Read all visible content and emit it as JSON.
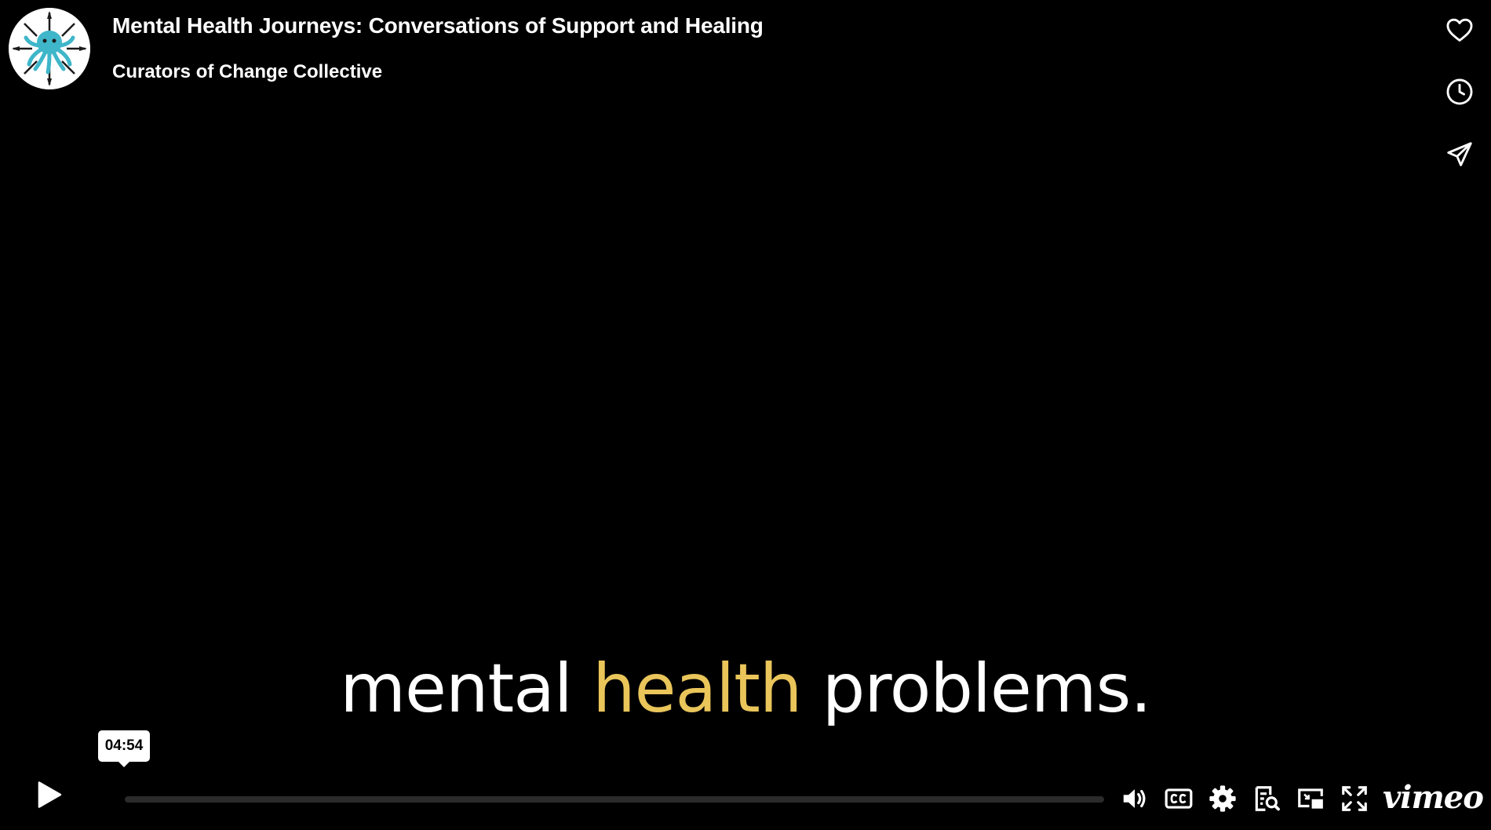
{
  "video": {
    "title": "Mental Health Journeys: Conversations of Support and Healing",
    "byline": "Curators of Change Collective"
  },
  "side_actions": [
    {
      "name": "like",
      "icon": "heart-icon"
    },
    {
      "name": "watch-later",
      "icon": "clock-icon"
    },
    {
      "name": "share",
      "icon": "paper-plane-icon"
    }
  ],
  "caption": {
    "before": "mental ",
    "highlight": "health",
    "after": " problems."
  },
  "player": {
    "hover_time": "04:54",
    "progress_fraction": 0,
    "brand": "vimeo"
  },
  "colors": {
    "background": "#000000",
    "caption_highlight": "#e9c55a",
    "progress_track": "#2b2b2b"
  }
}
